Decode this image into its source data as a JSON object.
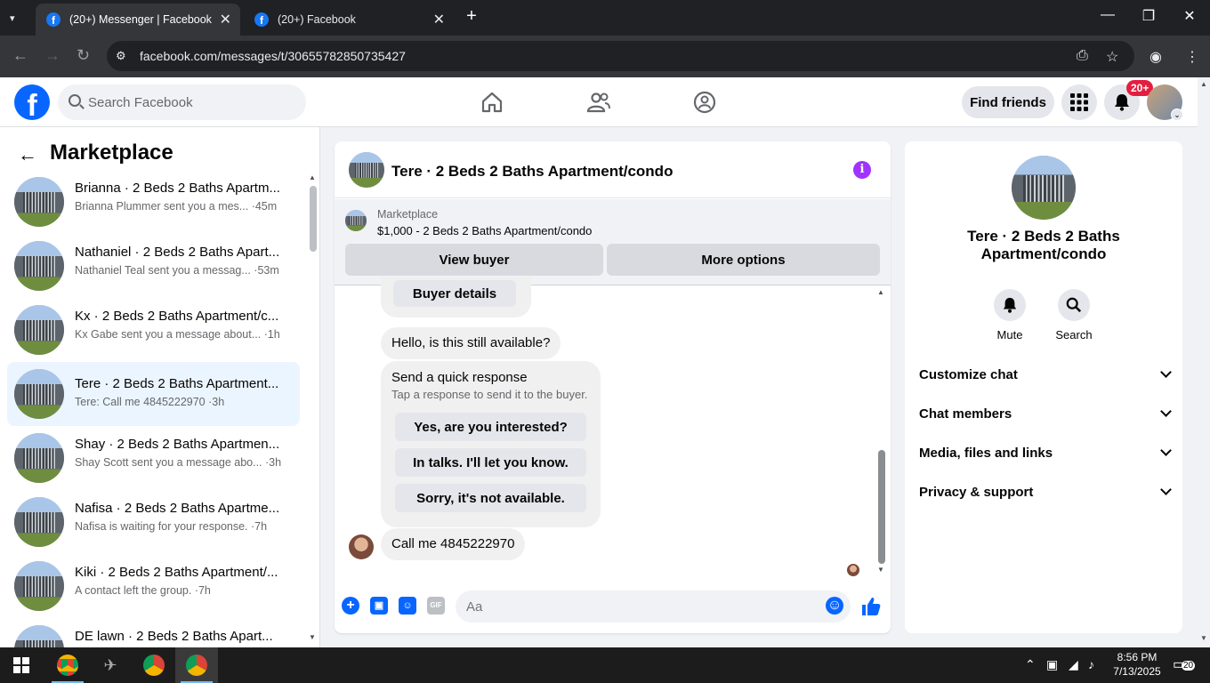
{
  "browser": {
    "tabs": [
      {
        "title": "(20+) Messenger | Facebook",
        "active": true
      },
      {
        "title": "(20+) Facebook",
        "active": false
      }
    ],
    "url": "facebook.com/messages/t/30655782850735427"
  },
  "header": {
    "search_placeholder": "Search Facebook",
    "find_friends": "Find friends",
    "notification_badge": "20+"
  },
  "sidebar": {
    "title": "Marketplace",
    "conversations": [
      {
        "name": "Brianna · 2 Beds 2 Baths Apartm...",
        "preview": "Brianna Plummer sent you a mes... ·45m"
      },
      {
        "name": "Nathaniel · 2 Beds 2 Baths Apart...",
        "preview": "Nathaniel Teal sent you a messag... ·53m"
      },
      {
        "name": "Kx · 2 Beds 2 Baths Apartment/c...",
        "preview": "Kx Gabe sent you a message about... ·1h"
      },
      {
        "name": "Tere · 2 Beds 2 Baths Apartment...",
        "preview": "Tere: Call me 4845222970 ·3h"
      },
      {
        "name": "Shay · 2 Beds 2 Baths Apartmen...",
        "preview": "Shay Scott sent you a message abo... ·3h"
      },
      {
        "name": "Nafisa · 2 Beds 2 Baths Apartme...",
        "preview": "Nafisa is waiting for your response. ·7h"
      },
      {
        "name": "Kiki · 2 Beds 2 Baths Apartment/...",
        "preview": "A contact left the group. ·7h"
      },
      {
        "name": "DE lawn · 2 Beds 2 Baths Apart...",
        "preview": ""
      }
    ]
  },
  "chat": {
    "title": "Tere · 2 Beds 2 Baths Apartment/condo",
    "marketplace_label": "Marketplace",
    "listing": "$1,000 - 2 Beds 2 Baths Apartment/condo",
    "view_buyer": "View buyer",
    "more_options": "More options",
    "buyer_details": "Buyer details",
    "msg_available": "Hello, is this still available?",
    "quick_title": "Send a quick response",
    "quick_sub": "Tap a response to send it to the buyer.",
    "quick_1": "Yes, are you interested?",
    "quick_2": "In talks. I'll let you know.",
    "quick_3": "Sorry, it's not available.",
    "msg_call": "Call me 4845222970",
    "composer_placeholder": "Aa"
  },
  "details": {
    "title": "Tere · 2 Beds 2 Baths Apartment/condo",
    "mute": "Mute",
    "search": "Search",
    "sections": [
      "Customize chat",
      "Chat members",
      "Media, files and links",
      "Privacy & support"
    ]
  },
  "taskbar": {
    "time": "8:56 PM",
    "date": "7/13/2025",
    "notif_count": "20"
  }
}
